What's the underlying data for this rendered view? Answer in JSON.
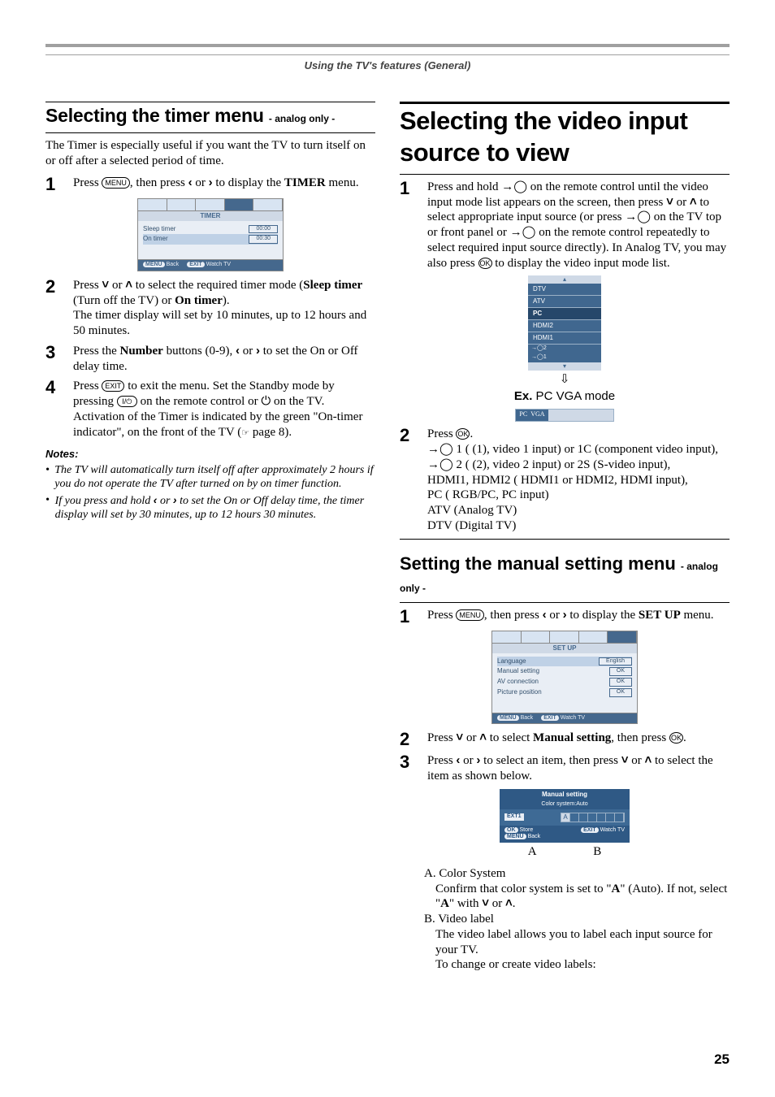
{
  "header": "Using the TV's features (General)",
  "left": {
    "title": "Selecting the timer menu ",
    "subtitle": "- analog only -",
    "lead": "The Timer is especially useful if you want the TV to turn itself on or off after a selected period of time.",
    "s1": {
      "num": "1",
      "a": "Press ",
      "menu": "MENU",
      "b": ", then press ",
      "c": " or ",
      "d": " to display the ",
      "e": "TIMER",
      "f": " menu."
    },
    "osd": {
      "title": "TIMER",
      "r1": {
        "k": "Sleep timer",
        "v": "00:00"
      },
      "r2": {
        "k": "On timer",
        "v": "00:30"
      },
      "foot": {
        "k1": "MENU",
        "t1": "Back",
        "k2": "EXIT",
        "t2": "Watch TV"
      }
    },
    "s2": {
      "num": "2",
      "a": "Press ",
      "b": " or ",
      "c": " to select the required timer mode (",
      "d": "Sleep timer",
      "e": " (Turn off the TV) or ",
      "f": "On timer",
      "g": ").",
      "h": "The timer display will set by 10 minutes, up to 12 hours and 50 minutes."
    },
    "s3": {
      "num": "3",
      "a": "Press the ",
      "b": "Number",
      "c": " buttons (0-9), ",
      "d": " or ",
      "e": " to set the On or Off delay time."
    },
    "s4": {
      "num": "4",
      "a": "Press ",
      "exit": "EXIT",
      "b": " to exit the menu. Set the Standby mode by pressing ",
      "c": " on the remote control or ",
      "d": " on the TV. Activation of the Timer is indicated by the green \"On-timer indicator\", on the front of the TV (",
      "e": " page 8)."
    },
    "notes": "Notes:",
    "n1": "The TV will automatically turn itself off after approximately 2 hours if you do not operate the TV after turned on by on timer function.",
    "n2a": "If you press and hold ",
    "n2b": " or ",
    "n2c": " to set the On or Off delay time, the timer display will set by 30 minutes, up to 12 hours 30 minutes."
  },
  "right": {
    "title": "Selecting the video input source to view",
    "s1": {
      "num": "1",
      "a": "Press and hold ",
      "b": " on the remote control until the video input mode list appears on the screen, then press ",
      "c": " or ",
      "d": " to select appropriate input source (or press ",
      "e": " on the TV top or front panel or ",
      "f": " on the remote control repeatedly to select required input source directly). In Analog TV, you may also press ",
      "ok": "OK",
      "g": " to display the video input mode list."
    },
    "inputs": [
      "DTV",
      "ATV",
      "PC",
      "HDMI2",
      "HDMI1"
    ],
    "inputs_small": [
      "2",
      "1"
    ],
    "ex": {
      "label": "Ex.",
      "text": " PC VGA mode",
      "bar_a": "PC",
      "bar_b": "VGA"
    },
    "s2": {
      "num": "2",
      "a": "Press ",
      "ok": "OK",
      "b": ".",
      "lines": [
        " 1 ( (1), video 1 input) or  1C (component video input),",
        " 2 ( (2), video 2 input) or  2S (S-video input),",
        "HDMI1, HDMI2 ( HDMI1 or  HDMI2, HDMI input),",
        "PC ( RGB/PC, PC input)",
        "ATV (Analog TV)",
        "DTV (Digital TV)"
      ]
    },
    "h2": "Setting the manual setting menu ",
    "h2sub": "- analog only -",
    "ms1": {
      "num": "1",
      "a": "Press ",
      "menu": "MENU",
      "b": ", then press ",
      "c": " or ",
      "d": " to display the ",
      "e": "SET UP",
      "f": " menu."
    },
    "osd2": {
      "title": "SET UP",
      "rows": [
        {
          "k": "Language",
          "v": "English"
        },
        {
          "k": "Manual setting",
          "v": "OK"
        },
        {
          "k": "AV connection",
          "v": "OK"
        },
        {
          "k": "Picture position",
          "v": "OK"
        }
      ],
      "foot": {
        "k1": "MENU",
        "t1": "Back",
        "k2": "EXIT",
        "t2": "Watch TV"
      }
    },
    "ms2": {
      "num": "2",
      "a": "Press ",
      "b": " or ",
      "c": " to select ",
      "d": "Manual setting",
      "e": ", then press ",
      "ok": "OK",
      "f": "."
    },
    "ms3": {
      "num": "3",
      "a": "Press ",
      "b": " or ",
      "c": " to select an item, then press ",
      "d": " or ",
      "e": " to select the item as shown below."
    },
    "msosd": {
      "t1": "Manual setting",
      "t2": "Color system:Auto",
      "lbl": "EXT1",
      "side": {
        "k1": "OK",
        "t1": "Store",
        "k2": "MENU",
        "t2": "Back",
        "k3": "EXIT",
        "t3": "Watch TV"
      }
    },
    "mslabels": {
      "a": "A",
      "b": "B"
    },
    "defs": {
      "Aa": "A. Color System",
      "Ab": "Confirm that color system is set to \"",
      "Ac": "A",
      "Ad": "\" (Auto). If not, select \"",
      "Ae": "A",
      "Af": "\" with ",
      "Ag": " or ",
      "Ah": ".",
      "Ba": "B. Video label",
      "Bb": "The video label allows you to label each input source for your TV.",
      "Bc": "To change or create video labels:"
    }
  },
  "page": "25"
}
